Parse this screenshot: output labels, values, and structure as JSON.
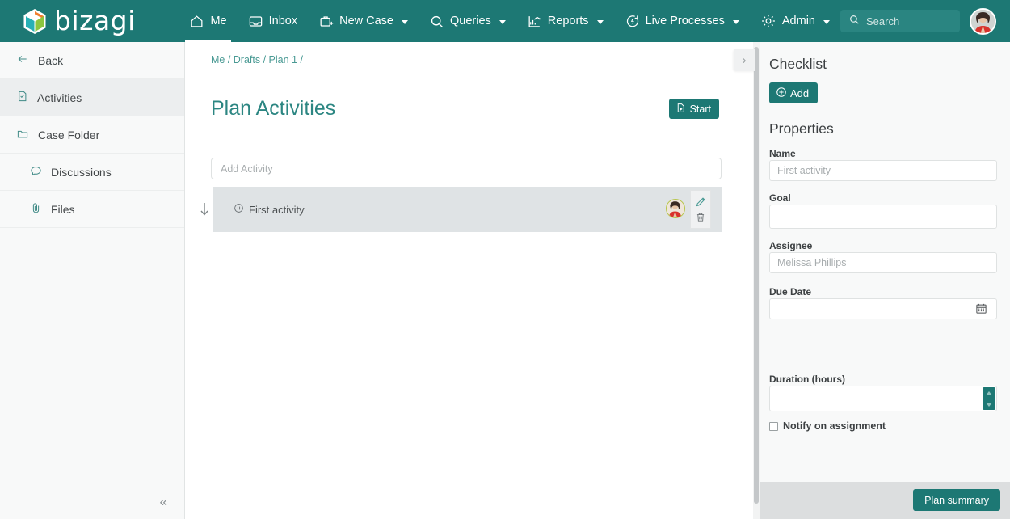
{
  "brand": {
    "name": "bizagi",
    "logo_icon": "bizagi-hex-logo"
  },
  "topnav": {
    "items": [
      {
        "label": "Me",
        "icon": "home-icon",
        "caret": false,
        "active": true
      },
      {
        "label": "Inbox",
        "icon": "inbox-icon",
        "caret": false,
        "active": false
      },
      {
        "label": "New Case",
        "icon": "new-case-icon",
        "caret": true,
        "active": false
      },
      {
        "label": "Queries",
        "icon": "search-icon",
        "caret": true,
        "active": false
      },
      {
        "label": "Reports",
        "icon": "reports-chart-icon",
        "caret": true,
        "active": false
      },
      {
        "label": "Live Processes",
        "icon": "live-processes-icon",
        "caret": true,
        "active": false
      },
      {
        "label": "Admin",
        "icon": "gear-icon",
        "caret": true,
        "active": false
      }
    ],
    "search": {
      "placeholder": "Search",
      "icon": "search-icon"
    },
    "avatar": {
      "name": "user-avatar"
    }
  },
  "sidebar": {
    "items": [
      {
        "label": "Back",
        "icon": "arrow-left-icon",
        "selected": false,
        "sub": false
      },
      {
        "label": "Activities",
        "icon": "activities-doc-icon",
        "selected": true,
        "sub": false
      },
      {
        "label": "Case Folder",
        "icon": "folder-icon",
        "selected": false,
        "sub": false
      },
      {
        "label": "Discussions",
        "icon": "comment-icon",
        "selected": false,
        "sub": true
      },
      {
        "label": "Files",
        "icon": "paperclip-icon",
        "selected": false,
        "sub": true
      }
    ],
    "collapse_icon": "«"
  },
  "main": {
    "breadcrumb": "Me / Drafts / Plan 1 /",
    "breadcrumb_parts": [
      "Me",
      "Drafts",
      "Plan 1"
    ],
    "title": "Plan Activities",
    "start_button": {
      "label": "Start",
      "icon": "start-doc-play-icon"
    },
    "add_activity_placeholder": "Add Activity",
    "activity": {
      "name": "First activity",
      "status_icon": "pause-circle-icon",
      "drag_icon": "drag-down-arrow-icon",
      "edit_icon": "pencil-icon",
      "delete_icon": "trash-icon",
      "avatar": "assignee-avatar"
    },
    "panel_toggle_icon": "›"
  },
  "rightpanel": {
    "checklist_heading": "Checklist",
    "add_button": {
      "label": "Add",
      "icon": "plus-circle-icon"
    },
    "properties_heading": "Properties",
    "fields": [
      {
        "label": "Name",
        "value": "",
        "placeholder": "First activity"
      },
      {
        "label": "Goal",
        "value": "",
        "placeholder": ""
      },
      {
        "label": "Assignee",
        "value": "",
        "placeholder": "Melissa Phillips"
      },
      {
        "label": "Due Date",
        "value": "",
        "placeholder": "",
        "icon": "calendar-icon"
      },
      {
        "label": "Duration (hours)",
        "value": "",
        "placeholder": "",
        "icon": "spinner-icon"
      }
    ],
    "notify_checkbox": {
      "label": "Notify on assignment",
      "checked": false
    },
    "footer_button": "Plan summary"
  },
  "colors": {
    "brand_teal": "#1d7874",
    "nav_bg": "#1d7874",
    "title_teal": "#2c8682",
    "breadcrumb_teal": "#4a9a94",
    "row_gray": "#dfe3e5",
    "panel_bg": "#f8f9f9",
    "footer_gray": "#dcdedf"
  }
}
